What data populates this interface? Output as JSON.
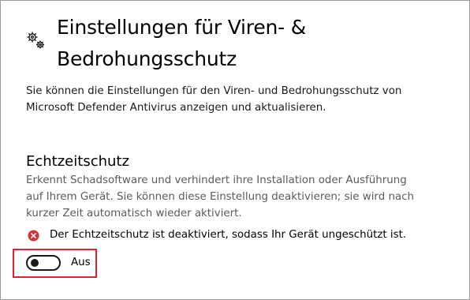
{
  "header": {
    "icon": "gears-icon",
    "title_line1": "Einstellungen für Viren- &",
    "title_line2": "Bedrohungsschutz"
  },
  "description": {
    "line1": "Sie können die Einstellungen für den Viren- und Bedrohungsschutz von",
    "line2": "Microsoft Defender Antivirus anzeigen und aktualisieren."
  },
  "realtime": {
    "heading": "Echtzeitschutz",
    "desc_line1": "Erkennt Schadsoftware und verhindert ihre Installation oder Ausführung",
    "desc_line2": "auf Ihrem Gerät. Sie können diese Einstellung deaktivieren; sie wird nach",
    "desc_line3": "kurzer Zeit automatisch wieder aktiviert.",
    "warning_icon": "error-x-icon",
    "warning_text": "Der Echtzeitschutz ist deaktiviert, sodass Ihr Gerät ungeschützt ist.",
    "toggle_state": "off",
    "toggle_label": "Aus"
  },
  "colors": {
    "error_red": "#d13438",
    "highlight_red": "#e5202e",
    "secondary_text": "#5b5b5b"
  }
}
